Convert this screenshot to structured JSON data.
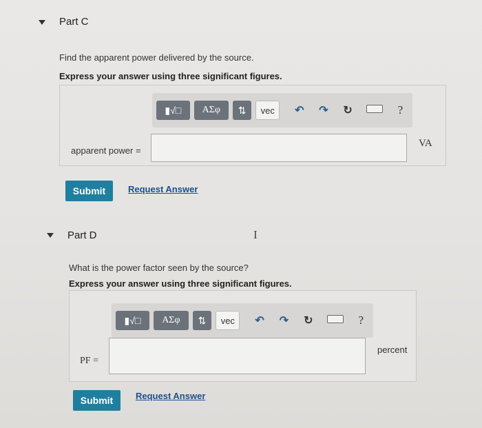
{
  "part_c": {
    "title": "Part C",
    "question": "Find the apparent power delivered by the source.",
    "instruction": "Express your answer using three significant figures.",
    "toolbar": {
      "templates": "▮√□",
      "symbols": "ΑΣφ",
      "arrows": "⇅",
      "vec": "vec",
      "undo": "↶",
      "redo": "↷",
      "reset": "↻",
      "help": "?"
    },
    "answer_label": "apparent power =",
    "answer_value": "",
    "unit": "VA",
    "submit_label": "Submit",
    "request_label": "Request Answer"
  },
  "part_d": {
    "title": "Part D",
    "question": "What is the power factor seen by the source?",
    "instruction": "Express your answer using three significant figures.",
    "toolbar": {
      "templates": "▮√□",
      "symbols": "ΑΣφ",
      "arrows": "⇅",
      "vec": "vec",
      "undo": "↶",
      "redo": "↷",
      "reset": "↻",
      "help": "?"
    },
    "answer_label": "PF =",
    "answer_value": "",
    "unit": "percent",
    "submit_label": "Submit",
    "request_label": "Request Answer"
  },
  "cursor_glyph": "I"
}
